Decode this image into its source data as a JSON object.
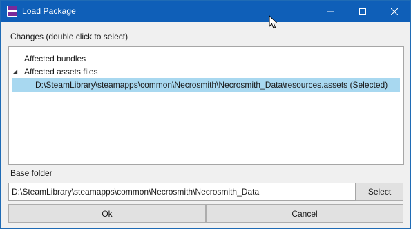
{
  "window": {
    "title": "Load Package"
  },
  "titlebar_buttons": {
    "minimize_icon": "minimize-icon",
    "maximize_icon": "maximize-icon",
    "close_icon": "close-icon"
  },
  "changes": {
    "label": "Changes (double click to select)",
    "tree": {
      "items": [
        {
          "label": "Affected bundles"
        },
        {
          "label": "Affected assets files",
          "expanded": true
        },
        {
          "label": "D:\\SteamLibrary\\steamapps\\common\\Necrosmith\\Necrosmith_Data\\resources.assets (Selected)",
          "selected": true
        }
      ]
    }
  },
  "base_folder": {
    "label": "Base folder",
    "value": "D:\\SteamLibrary\\steamapps\\common\\Necrosmith\\Necrosmith_Data",
    "select_label": "Select"
  },
  "actions": {
    "ok_label": "Ok",
    "cancel_label": "Cancel"
  },
  "colors": {
    "titlebar": "#0f5fb8",
    "selection": "#a8d8f0",
    "window_bg": "#f0f0f0"
  }
}
